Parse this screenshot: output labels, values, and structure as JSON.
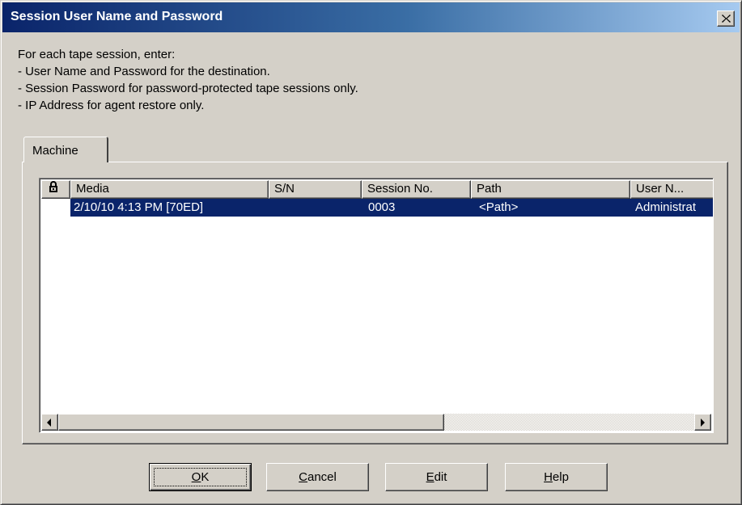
{
  "window": {
    "title": "Session User Name and Password",
    "close_icon": "close-icon"
  },
  "instructions": {
    "line1": "For each tape session, enter:",
    "line2": "- User Name and Password for the destination.",
    "line3": "- Session Password for password-protected tape sessions only.",
    "line4": "- IP Address for agent restore only."
  },
  "tabs": [
    {
      "label": "Machine",
      "selected": true
    }
  ],
  "table": {
    "lock_icon": "lock-icon",
    "columns": {
      "media": "Media",
      "sn": "S/N",
      "session": "Session No.",
      "path": "Path",
      "user": "User N..."
    },
    "rows": [
      {
        "media": "2/10/10 4:13 PM [70ED]",
        "sn": "",
        "session": "0003",
        "path": "<Path>",
        "user": "Administrat",
        "selected": true
      }
    ]
  },
  "scrollbar": {
    "left_icon": "arrow-left-icon",
    "right_icon": "arrow-right-icon"
  },
  "buttons": {
    "ok": {
      "key": "O",
      "rest": "K"
    },
    "cancel": {
      "key": "C",
      "rest": "ancel"
    },
    "edit": {
      "key": "E",
      "rest": "dit"
    },
    "help": {
      "key": "H",
      "rest": "elp"
    }
  },
  "colors": {
    "title_gradient_start": "#0a246a",
    "title_gradient_end": "#a6caf0",
    "face": "#d4d0c8",
    "selection": "#0a246a"
  }
}
